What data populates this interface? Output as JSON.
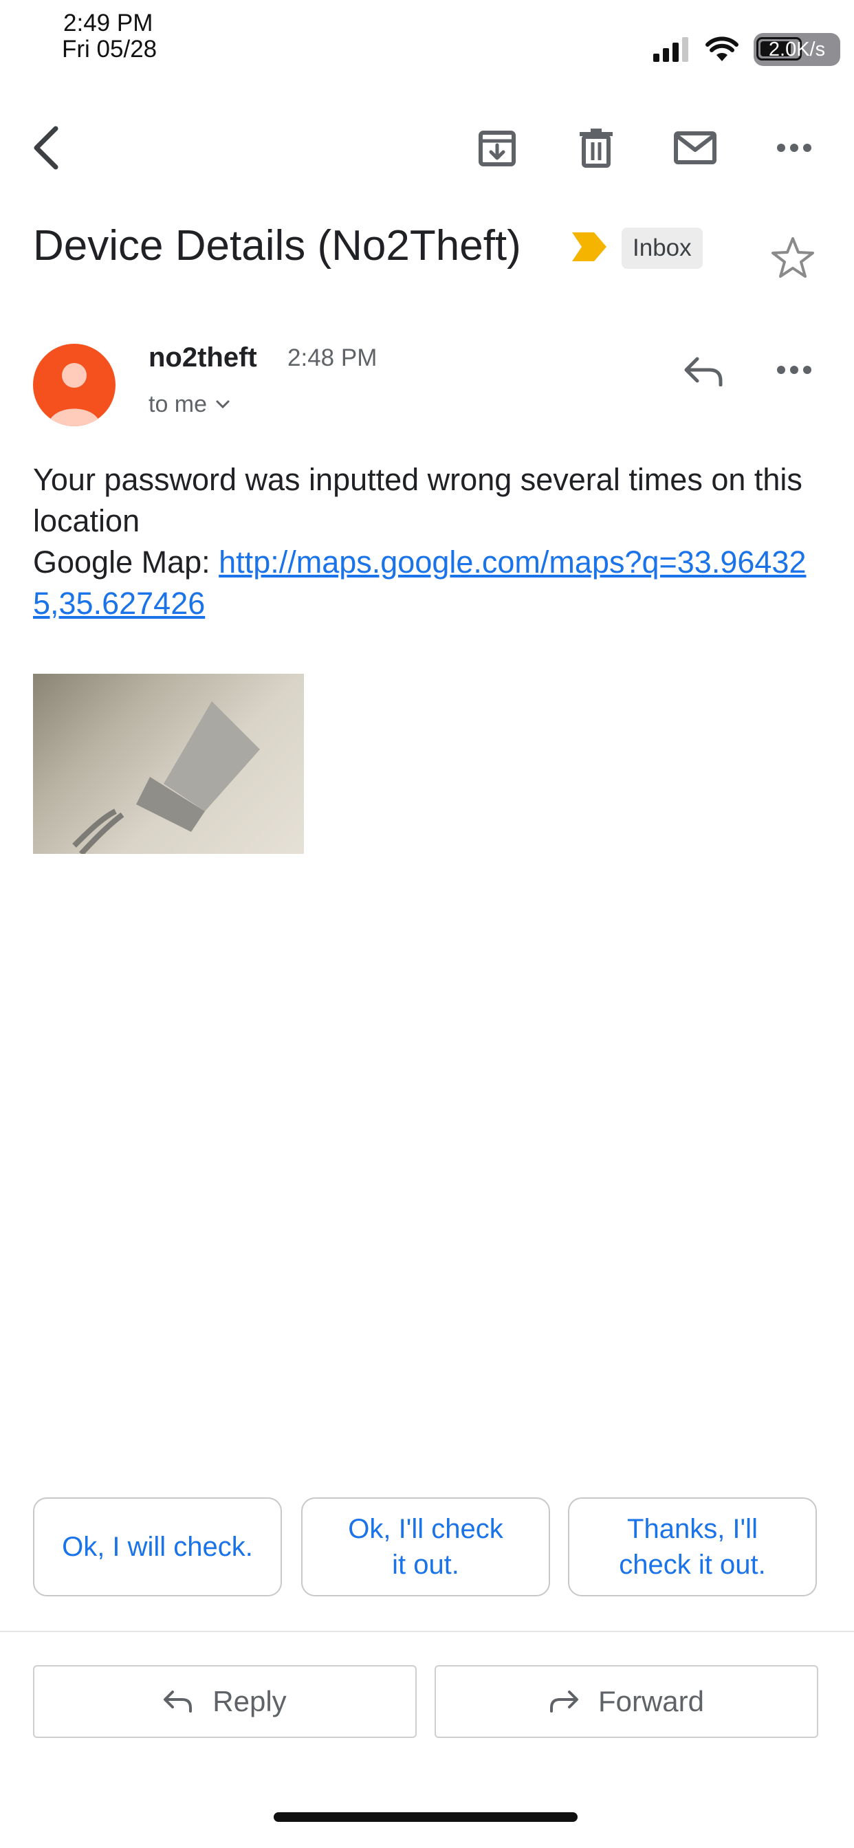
{
  "status_bar": {
    "time": "2:49 PM",
    "date": "Fri 05/28",
    "net_speed": "2.0K/s"
  },
  "toolbar": {
    "icons": [
      "back-icon",
      "archive-icon",
      "delete-icon",
      "mark-unread-icon",
      "more-icon"
    ]
  },
  "email": {
    "subject": "Device Details (No2Theft)",
    "label": "Inbox",
    "sender": "no2theft",
    "time": "2:48 PM",
    "recipient": "to me",
    "body_line1": "Your password was inputted wrong several times on this location",
    "map_prefix": "Google Map: ",
    "map_link": "http://maps.google.com/maps?q=33.964325,35.627426"
  },
  "smart_replies": [
    {
      "label": "Ok, I will check."
    },
    {
      "label": "Ok, I'll check it out."
    },
    {
      "label": "Thanks, I'll check it out."
    }
  ],
  "actions": {
    "reply": "Reply",
    "forward": "Forward"
  },
  "colors": {
    "accent": "#1a73e8",
    "avatar": "#f4511e",
    "label_marker": "#f4b400"
  }
}
